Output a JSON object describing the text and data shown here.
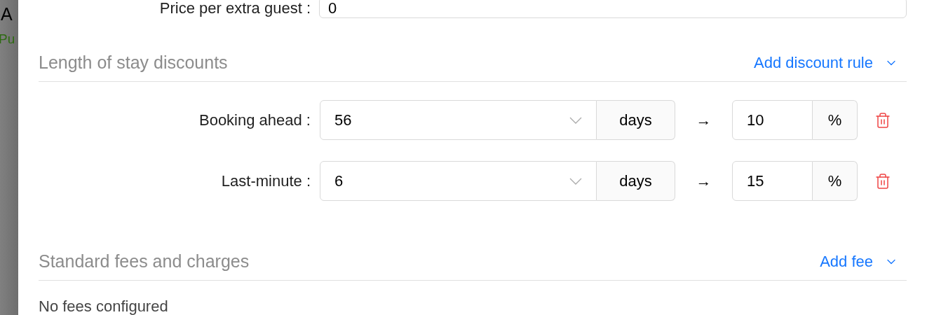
{
  "background": {
    "title": "A",
    "status": "Pu"
  },
  "extra_guest": {
    "label": "Price per extra guest :",
    "value": "0"
  },
  "discounts": {
    "title": "Length of stay discounts",
    "add_label": "Add discount rule",
    "rules": [
      {
        "label": "Booking ahead :",
        "days": "56",
        "unit": "days",
        "arrow": "→",
        "percent": "10",
        "percent_unit": "%"
      },
      {
        "label": "Last-minute :",
        "days": "6",
        "unit": "days",
        "arrow": "→",
        "percent": "15",
        "percent_unit": "%"
      }
    ]
  },
  "fees": {
    "title": "Standard fees and charges",
    "add_label": "Add fee",
    "empty": "No fees configured"
  }
}
